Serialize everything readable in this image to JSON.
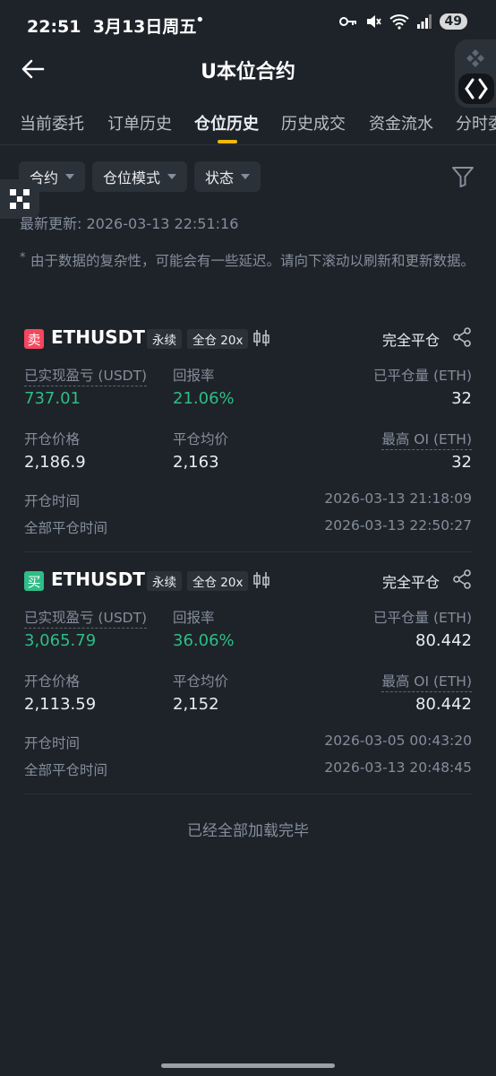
{
  "status_bar": {
    "time": "22:51",
    "date": "3月13日周五",
    "dot": "•",
    "battery": "49"
  },
  "header": {
    "title": "U本位合约"
  },
  "tabs": [
    "当前委托",
    "订单历史",
    "仓位历史",
    "历史成交",
    "资金流水",
    "分时委"
  ],
  "active_tab_index": 2,
  "filters": {
    "contract": "合约",
    "position_mode": "仓位模式",
    "status": "状态"
  },
  "last_update": "最新更新: 2026-03-13 22:51:16",
  "notice": {
    "star": "*",
    "text": "由于数据的复杂性，可能会有一些延迟。请向下滚动以刷新和更新数据。"
  },
  "positions": [
    {
      "side": "卖",
      "symbol": "ETHUSDT",
      "type": "永续",
      "margin": "全仓 20x",
      "close_status": "完全平仓",
      "labels": {
        "realized_pnl": "已实现盈亏 (USDT)",
        "roi": "回报率",
        "closed_qty": "已平仓量 (ETH)",
        "entry_price": "开仓价格",
        "avg_close": "平仓均价",
        "max_oi": "最高 OI (ETH)",
        "open_time": "开仓时间",
        "close_time": "全部平仓时间"
      },
      "realized_pnl": "737.01",
      "roi": "21.06%",
      "closed_qty": "32",
      "entry_price": "2,186.9",
      "avg_close": "2,163",
      "max_oi": "32",
      "open_time": "2026-03-13 21:18:09",
      "close_time": "2026-03-13 22:50:27"
    },
    {
      "side": "买",
      "symbol": "ETHUSDT",
      "type": "永续",
      "margin": "全仓 20x",
      "close_status": "完全平仓",
      "labels": {
        "realized_pnl": "已实现盈亏 (USDT)",
        "roi": "回报率",
        "closed_qty": "已平仓量 (ETH)",
        "entry_price": "开仓价格",
        "avg_close": "平仓均价",
        "max_oi": "最高 OI (ETH)",
        "open_time": "开仓时间",
        "close_time": "全部平仓时间"
      },
      "realized_pnl": "3,065.79",
      "roi": "36.06%",
      "closed_qty": "80.442",
      "entry_price": "2,113.59",
      "avg_close": "2,152",
      "max_oi": "80.442",
      "open_time": "2026-03-05 00:43:20",
      "close_time": "2026-03-13 20:48:45"
    }
  ],
  "end_text": "已经全部加载完毕",
  "colors": {
    "background": "#1e2329",
    "sell": "#f6465d",
    "buy": "#2ebd85",
    "accent": "#f0b90b",
    "muted": "#848e9c"
  }
}
